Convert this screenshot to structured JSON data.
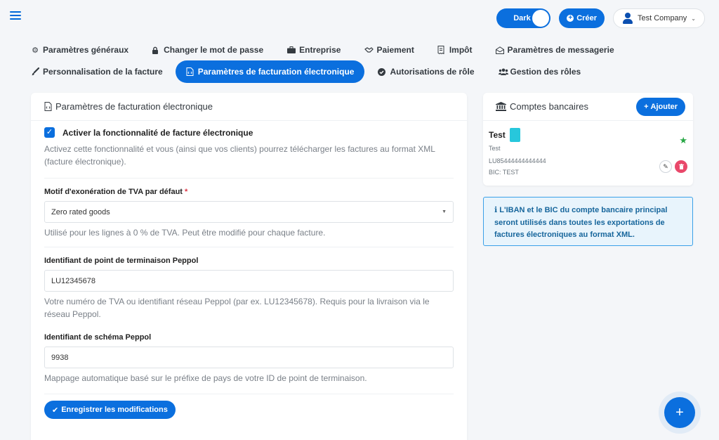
{
  "topbar": {
    "dark_label": "Dark",
    "create_label": "Créer",
    "company_name": "Test Company"
  },
  "tabs_row1": [
    {
      "label": "Paramètres généraux",
      "icon": "gear-icon"
    },
    {
      "label": "Changer le mot de passe",
      "icon": "lock-icon"
    },
    {
      "label": "Entreprise",
      "icon": "briefcase-icon"
    },
    {
      "label": "Paiement",
      "icon": "handshake-icon"
    },
    {
      "label": "Impôt",
      "icon": "receipt-icon"
    },
    {
      "label": "Paramètres de messagerie",
      "icon": "envelope-open-icon"
    }
  ],
  "tabs_row2": [
    {
      "label": "Personnalisation de la facture",
      "icon": "paintbrush-icon"
    },
    {
      "label": "Paramètres de facturation électronique",
      "icon": "file-code-icon",
      "active": true
    },
    {
      "label": "Autorisations de rôle",
      "icon": "check-circle-icon"
    },
    {
      "label": "Gestion des rôles",
      "icon": "users-icon"
    }
  ],
  "einvoice": {
    "title": "Paramètres de facturation électronique",
    "enable_label": "Activer la fonctionnalité de facture électronique",
    "enable_checked": true,
    "enable_help": "Activez cette fonctionnalité et vous (ainsi que vos clients) pourrez télécharger les factures au format XML (facture électronique).",
    "vat_label": "Motif d'exonération de TVA par défaut",
    "vat_required_mark": "*",
    "vat_value": "Zero rated goods",
    "vat_help": "Utilisé pour les lignes à 0 % de TVA. Peut être modifié pour chaque facture.",
    "peppol_endpoint_label": "Identifiant de point de terminaison Peppol",
    "peppol_endpoint_value": "LU12345678",
    "peppol_endpoint_help": "Votre numéro de TVA ou identifiant réseau Peppol (par ex. LU12345678). Requis pour la livraison via le réseau Peppol.",
    "peppol_scheme_label": "Identifiant de schéma Peppol",
    "peppol_scheme_value": "9938",
    "peppol_scheme_help": "Mappage automatique basé sur le préfixe de pays de votre ID de point de terminaison.",
    "save_label": "Enregistrer les modifications"
  },
  "bank": {
    "title": "Comptes bancaires",
    "add_label": "Ajouter",
    "account": {
      "name": "Test",
      "subtitle": "Test",
      "iban": "LU85444444444444",
      "bic": "BIC: TEST",
      "swatch_color": "#27c7dc"
    }
  },
  "info": {
    "text": "L'IBAN et le BIC du compte bancaire principal seront utilisés dans toutes les exportations de factures électroniques au format XML."
  },
  "colors": {
    "accent": "#0b6fde",
    "star": "#28a745",
    "danger": "#e9486a"
  }
}
